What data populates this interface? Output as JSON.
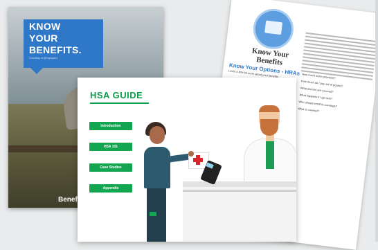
{
  "brochure": {
    "title_lines": [
      "KNOW",
      "YOUR",
      "BENEFITS."
    ],
    "subtitle": "Courtesy of [Employer]",
    "footer_logo": "Benefits"
  },
  "document": {
    "title": "Know Your Benefits",
    "subtitle": "Know Your Options - HRAs",
    "tagline": "Learn a little bit more about your benefits",
    "questions": [
      "How much is the premium?",
      "How much do I pay out of pocket?",
      "What doctors are covered?",
      "What happens if I get sick?",
      "Who should enroll in coverage?",
      "What is covered?"
    ]
  },
  "guide": {
    "title": "HSA GUIDE",
    "buttons": [
      "Introduction",
      "HSA 101",
      "Case Studies",
      "Appendix"
    ]
  },
  "colors": {
    "brand_green": "#12a651",
    "brand_blue": "#2f78c7",
    "pharmacy_red": "#d9252b"
  }
}
